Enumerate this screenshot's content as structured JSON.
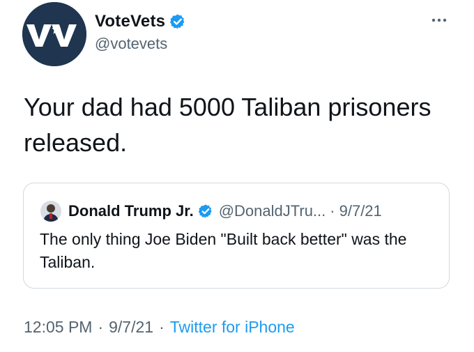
{
  "author": {
    "display_name": "VoteVets",
    "handle": "@votevets",
    "avatar_logo": "VV",
    "avatar_bg": "#1f3550",
    "verified_icon": "verified-badge-icon"
  },
  "tweet": {
    "text": "Your dad had 5000 Taliban prisoners released.",
    "time": "12:05 PM",
    "date": "9/7/21",
    "separator": "·",
    "source": "Twitter for iPhone"
  },
  "quoted": {
    "display_name": "Donald Trump Jr.",
    "handle": "@DonaldJTru...",
    "separator": "·",
    "date": "9/7/21",
    "text": "The only thing Joe Biden \"Built back better\" was the Taliban."
  },
  "colors": {
    "text": "#0f1419",
    "secondary": "#536471",
    "accent": "#1d9bf0",
    "border": "#cfd9de"
  },
  "icons": {
    "more": "more-options-icon",
    "verified": "verified-badge-icon"
  }
}
